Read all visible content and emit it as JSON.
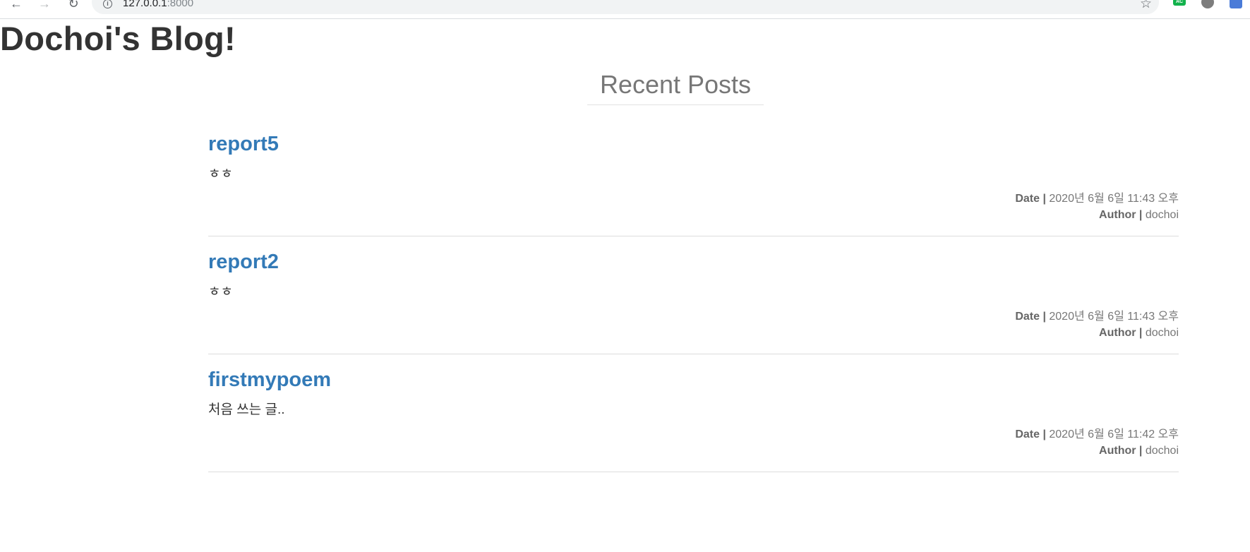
{
  "browser": {
    "url_host": "127.0.0.1",
    "url_port": ":8000",
    "extension_ac_label": "AC"
  },
  "page": {
    "blog_title": "Dochoi's Blog!",
    "section_heading": "Recent Posts"
  },
  "posts": [
    {
      "title": "report5",
      "body": "ㅎㅎ",
      "date_label": "Date |",
      "date_value": "2020년 6월 6일 11:43 오후",
      "author_label": "Author |",
      "author_value": "dochoi"
    },
    {
      "title": "report2",
      "body": "ㅎㅎ",
      "date_label": "Date |",
      "date_value": "2020년 6월 6일 11:43 오후",
      "author_label": "Author |",
      "author_value": "dochoi"
    },
    {
      "title": "firstmypoem",
      "body": "처음 쓰는 글..",
      "date_label": "Date |",
      "date_value": "2020년 6월 6일 11:42 오후",
      "author_label": "Author |",
      "author_value": "dochoi"
    }
  ]
}
